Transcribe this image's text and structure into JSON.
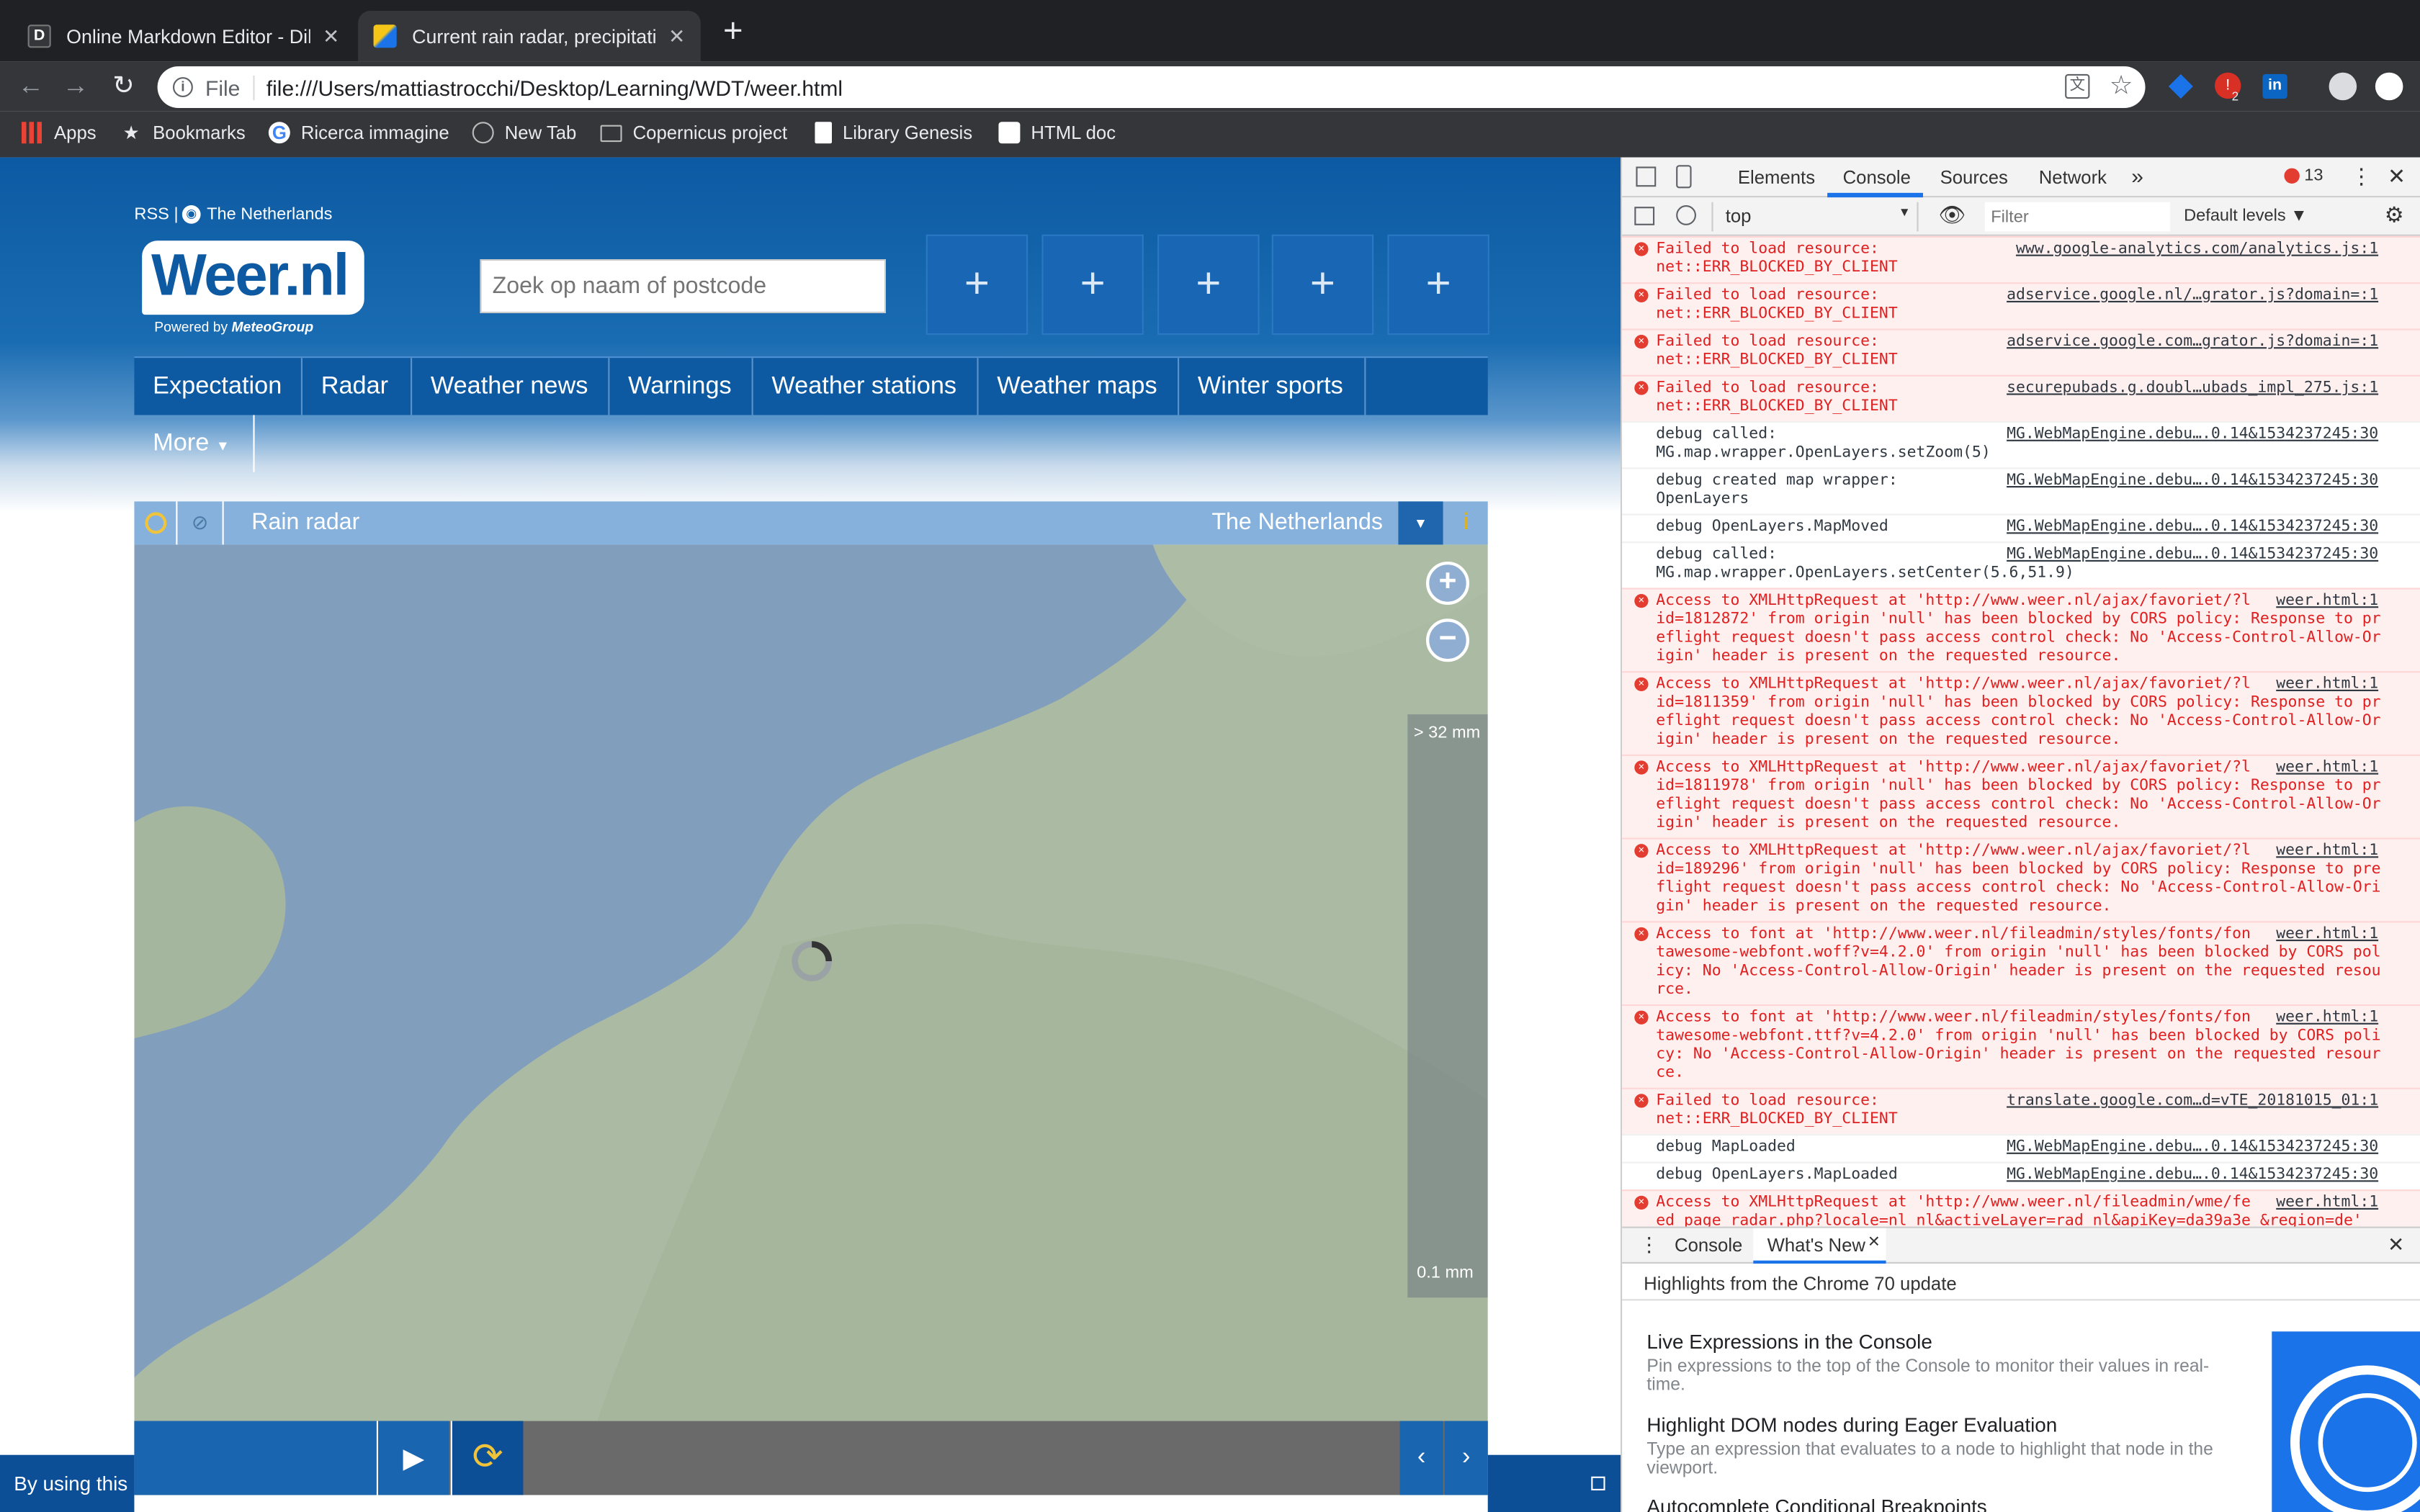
{
  "browser": {
    "tabs": [
      {
        "title": "Online Markdown Editor - Dillinger",
        "favicon": "D"
      },
      {
        "title": "Current rain radar, precipitation",
        "favicon": ""
      }
    ],
    "new_tab": "+",
    "address_scheme": "File",
    "address_url": "file:///Users/mattiastrocchi/Desktop/Learning/WDT/weer.html",
    "extension_badge": "2",
    "bookmarks": [
      "Apps",
      "Bookmarks",
      "Ricerca immagine",
      "New Tab",
      "Copernicus project",
      "Library Genesis",
      "HTML doc"
    ]
  },
  "page": {
    "rss": "RSS |",
    "region_link": "The Netherlands",
    "logo": "Weer.nl",
    "powered_by": "Powered by",
    "powered_brand": "MeteoGroup",
    "search_placeholder": "Zoek op naam of postcode",
    "favorite_slots": [
      "+",
      "+",
      "+",
      "+",
      "+"
    ],
    "nav": [
      "Expectation",
      "Radar",
      "Weather news",
      "Warnings",
      "Weather stations",
      "Weather maps",
      "Winter sports"
    ],
    "more": "More",
    "radar_title": "Rain radar",
    "radar_region": "The Netherlands",
    "legend_top": "> 32 mm",
    "legend_bottom": "0.1 mm",
    "cookie_text": "By using this",
    "legend_colors": [
      "#8a9dc6",
      "#7d9ed4",
      "#7ab4ea",
      "#86c6ef",
      "#94d6f2",
      "#a6e0f5",
      "#bde8f8"
    ]
  },
  "devtools": {
    "tabs": [
      "Elements",
      "Console",
      "Sources",
      "Network"
    ],
    "active_tab": "Console",
    "error_count": "13",
    "context": "top",
    "filter_placeholder": "Filter",
    "levels": "Default levels",
    "messages": [
      {
        "level": "error",
        "text": "Failed to load resource:\nnet::ERR_BLOCKED_BY_CLIENT",
        "source": "www.google-analytics.com/analytics.js:1"
      },
      {
        "level": "error",
        "text": "Failed to load resource:\nnet::ERR_BLOCKED_BY_CLIENT",
        "source": "adservice.google.nl/…grator.js?domain=:1"
      },
      {
        "level": "error",
        "text": "Failed to load resource:\nnet::ERR_BLOCKED_BY_CLIENT",
        "source": "adservice.google.com…grator.js?domain=:1"
      },
      {
        "level": "error",
        "text": "Failed to load resource:\nnet::ERR_BLOCKED_BY_CLIENT",
        "source": "securepubads.g.doubl…ubads_impl_275.js:1"
      },
      {
        "level": "debug",
        "text": "debug called:\nMG.map.wrapper.OpenLayers.setZoom(5)",
        "source": "MG.WebMapEngine.debu….0.14&1534237245:30"
      },
      {
        "level": "debug",
        "text": "debug created map wrapper:\nOpenLayers",
        "source": "MG.WebMapEngine.debu….0.14&1534237245:30"
      },
      {
        "level": "debug",
        "text": "debug OpenLayers.MapMoved",
        "source": "MG.WebMapEngine.debu….0.14&1534237245:30"
      },
      {
        "level": "debug",
        "text": "debug called:\nMG.map.wrapper.OpenLayers.setCenter(5.6,51.9)",
        "source": "MG.WebMapEngine.debu….0.14&1534237245:30"
      },
      {
        "level": "error",
        "text": "Access to XMLHttpRequest at 'http://www.weer.nl/ajax/favoriet/?l\nid=1812872' from origin 'null' has been blocked by CORS policy: Response to preflight request doesn't pass access control check: No 'Access-Control-Allow-Origin' header is present on the requested resource.",
        "source": "weer.html:1"
      },
      {
        "level": "error",
        "text": "Access to XMLHttpRequest at 'http://www.weer.nl/ajax/favoriet/?l\nid=1811359' from origin 'null' has been blocked by CORS policy: Response to preflight request doesn't pass access control check: No 'Access-Control-Allow-Origin' header is present on the requested resource.",
        "source": "weer.html:1"
      },
      {
        "level": "error",
        "text": "Access to XMLHttpRequest at 'http://www.weer.nl/ajax/favoriet/?l\nid=1811978' from origin 'null' has been blocked by CORS policy: Response to preflight request doesn't pass access control check: No 'Access-Control-Allow-Origin' header is present on the requested resource.",
        "source": "weer.html:1"
      },
      {
        "level": "error",
        "text": "Access to XMLHttpRequest at 'http://www.weer.nl/ajax/favoriet/?l\nid=189296' from origin 'null' has been blocked by CORS policy: Response to preflight request doesn't pass access control check: No 'Access-Control-Allow-Origin' header is present on the requested resource.",
        "source": "weer.html:1"
      },
      {
        "level": "error",
        "text": "Access to font at 'http://www.weer.nl/fileadmin/styles/fonts/fon\ntawesome-webfont.woff?v=4.2.0' from origin 'null' has been blocked by CORS policy: No 'Access-Control-Allow-Origin' header is present on the requested resource.",
        "source": "weer.html:1"
      },
      {
        "level": "error",
        "text": "Access to font at 'http://www.weer.nl/fileadmin/styles/fonts/fon\ntawesome-webfont.ttf?v=4.2.0' from origin 'null' has been blocked by CORS policy: No 'Access-Control-Allow-Origin' header is present on the requested resource.",
        "source": "weer.html:1"
      },
      {
        "level": "error",
        "text": "Failed to load resource:\nnet::ERR_BLOCKED_BY_CLIENT",
        "source": "translate.google.com…d=vTE_20181015_01:1"
      },
      {
        "level": "debug",
        "text": "debug MapLoaded",
        "source": "MG.WebMapEngine.debu….0.14&1534237245:30"
      },
      {
        "level": "debug",
        "text": "debug OpenLayers.MapLoaded",
        "source": "MG.WebMapEngine.debu….0.14&1534237245:30"
      },
      {
        "level": "error",
        "text": "Access to XMLHttpRequest at 'http://www.weer.nl/fileadmin/wme/fe\ned_page_radar.php?locale=nl_nl&activeLayer=rad_nl&apiKey=da39a3e &region=de'",
        "source": "weer.html:1"
      }
    ],
    "drawer_tabs": [
      "Console",
      "What's New"
    ],
    "highlights_title": "Highlights from the Chrome 70 update",
    "whats_new": [
      {
        "title": "Live Expressions in the Console",
        "desc": "Pin expressions to the top of the Console to monitor their values in real-time."
      },
      {
        "title": "Highlight DOM nodes during Eager Evaluation",
        "desc": "Type an expression that evaluates to a node to highlight that node in the viewport."
      },
      {
        "title": "Autocomplete Conditional Breakpoints",
        "desc": ""
      }
    ]
  }
}
